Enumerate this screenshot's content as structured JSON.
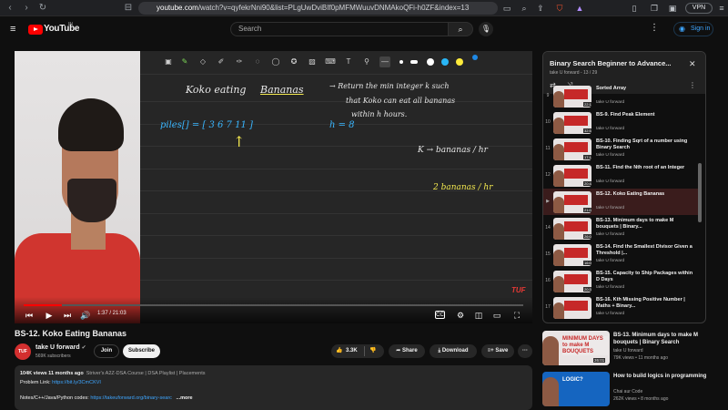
{
  "browser": {
    "url_domain": "youtube.com",
    "url_path": "/watch?v=qyfekrNni90&list=PLgUwDviBIf0pMFMWuuvDNMAkoQFi-h0ZF&index=13",
    "vpn_label": "VPN"
  },
  "header": {
    "logo_text": "YouTube",
    "logo_country": "IN",
    "search_placeholder": "Search",
    "signin_label": "Sign in"
  },
  "player": {
    "time": "1:37 / 21:03",
    "progress": 0.077,
    "watermark": "TUF",
    "board": {
      "title_left": "Koko eating",
      "title_right": "Bananas",
      "statement_line1": "→ Return the min integer k such",
      "statement_line2": "that Koko can eat all bananas",
      "statement_line3": "within h hours.",
      "piles": "piles[] = [ 3   6   7   11 ]",
      "h_value": "h = 8",
      "k_line": "K → bananas / hr",
      "two_line": "2  bananas / hr",
      "arrow_up": "↑"
    }
  },
  "video": {
    "title": "BS-12. Koko Eating Bananas",
    "channel": "take U forward",
    "subscribers": "569K subscribers",
    "avatar_text": "TUF",
    "join_label": "Join",
    "subscribe_label": "Subscribe",
    "likes": "3.3K",
    "share_label": "Share",
    "download_label": "Download",
    "save_label": "Save",
    "more_label": "···"
  },
  "description": {
    "stats": "104K views  11 months ago",
    "tags": "Striver's A2Z-DSA Course | DSA Playlist | Placements",
    "problem_label": "Problem Link: ",
    "problem_link": "https://bit.ly/3CmCKVI",
    "notes_label": "Notes/C++/Java/Python codes: ",
    "notes_link": "https://takeuforward.org/binary-searc",
    "more": "...more"
  },
  "playlist": {
    "title": "Binary Search Beginner to Advance...",
    "subtitle": "take U forward - 13 / 29",
    "items": [
      {
        "num": "9",
        "name": "Sorted Array",
        "channel": "take U forward",
        "duration": "22:16",
        "active": false
      },
      {
        "num": "10",
        "name": "BS-9. Find Peak Element",
        "channel": "take U forward",
        "duration": "32:53",
        "active": false
      },
      {
        "num": "11",
        "name": "BS-10. Finding Sqrt of a number using Binary Search",
        "channel": "take U forward",
        "duration": "17:13",
        "active": false
      },
      {
        "num": "12",
        "name": "BS-11. Find the Nth root of an Integer",
        "channel": "take U forward",
        "duration": "20:44",
        "active": false
      },
      {
        "num": "▶",
        "name": "BS-12. Koko Eating Bananas",
        "channel": "take U forward",
        "duration": "21:04",
        "active": true
      },
      {
        "num": "14",
        "name": "BS-13. Minimum days to make M bouquets | Binary...",
        "channel": "take U forward",
        "duration": "26:01",
        "active": false
      },
      {
        "num": "15",
        "name": "BS-14. Find the Smallest Divisor Given a Threshold |...",
        "channel": "take U forward",
        "duration": "16:09",
        "active": false
      },
      {
        "num": "16",
        "name": "BS-15. Capacity to Ship Packages within D Days",
        "channel": "take U forward",
        "duration": "20:36",
        "active": false
      },
      {
        "num": "17",
        "name": "BS-16. Kth Missing Positive Number | Maths + Binary...",
        "channel": "take U forward",
        "duration": "",
        "active": false
      }
    ]
  },
  "recommendations": [
    {
      "title": "BS-13. Minimum days to make M bouquets | Binary Search",
      "channel": "take U forward",
      "meta": "79K views • 11 months ago",
      "thumb_text": "MINIMUM DAYS to make M BOUQUETS",
      "duration": "26:01"
    },
    {
      "title": "How to build logics in programming",
      "channel": "Chai aur Code",
      "meta": "262K views • 8 months ago",
      "thumb_text": "LOGIC?",
      "duration": ""
    }
  ]
}
